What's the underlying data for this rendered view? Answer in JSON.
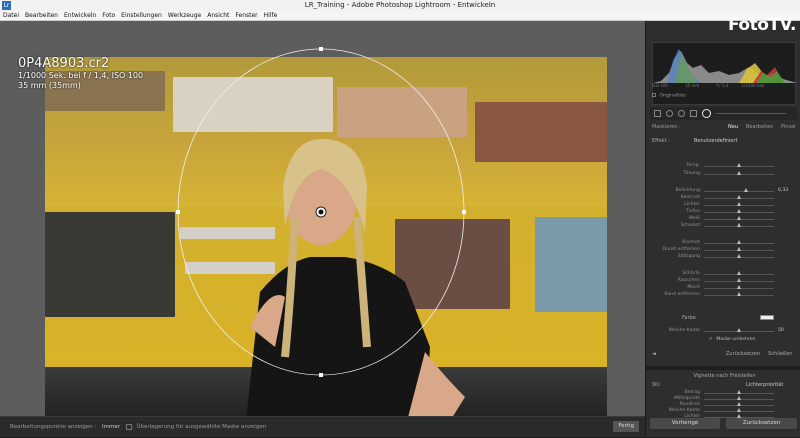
{
  "window": {
    "title": "LR_Training - Adobe Photoshop Lightroom - Entwickeln",
    "app_icon": "Lr"
  },
  "menu": [
    "Datei",
    "Bearbeiten",
    "Entwickeln",
    "Foto",
    "Einstellungen",
    "Werkzeuge",
    "Ansicht",
    "Fenster",
    "Hilfe"
  ],
  "photo_info": {
    "filename": "0P4A8903.cr2",
    "exposure": "1/1000 Sek. bei f / 1,4, ISO 100",
    "focal": "35 mm (35mm)"
  },
  "bottombar": {
    "toolbar_label": "Bearbeitungspunkte anzeigen :",
    "toolbar_value": "Immer",
    "overlay_label": "Überlagerung für ausgewählte Maske anzeigen",
    "done": "Fertig"
  },
  "logo": "FotoTV.",
  "histogram": {
    "meta_left": "ISO 100",
    "meta_mid": "35 mm",
    "meta_right": "f / 1,4",
    "meta_far": "1/1000 Sek.",
    "original_label": "Originalfoto"
  },
  "mask": {
    "label": "Maskieren :",
    "new": "Neu",
    "edit": "Bearbeiten",
    "brush": "Pinsel"
  },
  "effect": {
    "label": "Effekt :",
    "value": "Benutzerdefiniert"
  },
  "sliders": [
    {
      "label": "Temp.",
      "value": "",
      "pos": 0.5
    },
    {
      "label": "Tönung",
      "value": "",
      "pos": 0.5
    },
    {
      "label": "Belichtung",
      "value": "0,33",
      "pos": 0.6
    },
    {
      "label": "Kontrast",
      "value": "",
      "pos": 0.5
    },
    {
      "label": "Lichter",
      "value": "",
      "pos": 0.5
    },
    {
      "label": "Tiefen",
      "value": "",
      "pos": 0.5
    },
    {
      "label": "Weiß",
      "value": "",
      "pos": 0.5
    },
    {
      "label": "Schwarz",
      "value": "",
      "pos": 0.5
    },
    {
      "label": "Klarheit",
      "value": "",
      "pos": 0.5
    },
    {
      "label": "Dunst entfernen",
      "value": "",
      "pos": 0.5
    },
    {
      "label": "Sättigung",
      "value": "",
      "pos": 0.5
    },
    {
      "label": "Schärfe",
      "value": "",
      "pos": 0.5
    },
    {
      "label": "Rauschen",
      "value": "",
      "pos": 0.5
    },
    {
      "label": "Moiré",
      "value": "",
      "pos": 0.5
    },
    {
      "label": "Rand entfernen",
      "value": "",
      "pos": 0.5
    }
  ],
  "color": {
    "label": "Farbe"
  },
  "feather": {
    "label": "Weiche Kante",
    "value": "50",
    "pos": 0.5
  },
  "invert_label": "Maske umkehren",
  "panel_buttons": {
    "reset": "Zurücksetzen",
    "close": "Schließen"
  },
  "vignette": {
    "title": "Vignette nach Freistellen",
    "style_label": "Stil",
    "style_value": "Lichterpriorität"
  },
  "vignette_sliders": [
    {
      "label": "Betrag",
      "pos": 0.5
    },
    {
      "label": "Mittelpunkt",
      "pos": 0.5
    },
    {
      "label": "Rundheit",
      "pos": 0.5
    },
    {
      "label": "Weiche Kante",
      "pos": 0.5
    },
    {
      "label": "Lichter",
      "pos": 0.5
    }
  ],
  "footer_buttons": {
    "previous": "Vorherige",
    "reset": "Zurücksetzen"
  },
  "colors": {
    "accent": "#d4b02e",
    "panel": "#2e2e2e",
    "workspace": "#5d5d5d"
  }
}
